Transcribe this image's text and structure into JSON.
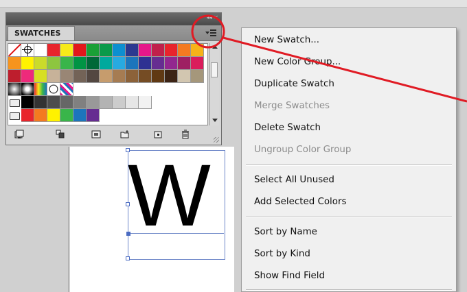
{
  "panel": {
    "tab_label": "SWATCHES",
    "menu_button_icon": "panel-flyout-menu-icon",
    "swatch_rows": [
      [
        "none",
        "registration",
        "#ffffff",
        "#e8252c",
        "#f6ea1a",
        "#e2171b",
        "#1aa036",
        "#0a9a4a",
        "#0d8fd0",
        "#2b3990",
        "#e5178a",
        "#c0204b",
        "#e8242c",
        "#f47a20",
        "#f6b319"
      ],
      [
        "#f7941d",
        "#fff200",
        "#cbdb2a",
        "#8dc63f",
        "#39b54a",
        "#009444",
        "#006838",
        "#00a99d",
        "#27aae1",
        "#1c75bc",
        "#2e3192",
        "#662d91",
        "#92278f",
        "#9e1f63",
        "#da1c5c"
      ],
      [
        "#be1e2d",
        "#ee2a7b",
        "#d7df23",
        "#c7b299",
        "#998675",
        "#736357",
        "#534741",
        "#c69c6d",
        "#a67c52",
        "#8c6239",
        "#754c24",
        "#603913",
        "#3c2415",
        "#d2c6b0",
        "#a5977b"
      ]
    ],
    "gradient_row": [
      "#c0c0c0",
      "#000000",
      "#e8a000",
      "#ffffff"
    ],
    "gray_row": [
      "#000000",
      "#333333",
      "#4d4d4d",
      "#666666",
      "#808080",
      "#999999",
      "#b3b3b3",
      "#cccccc",
      "#e6e6e6",
      "#f2f2f2"
    ],
    "color_group_row": [
      "#e8252c",
      "#f47a20",
      "#fff200",
      "#39b54a",
      "#1c75bc",
      "#662d91"
    ],
    "bottom_icons": [
      "swatch-libraries-menu-icon",
      "show-swatch-kinds-menu-icon",
      "swatch-options-icon",
      "new-color-group-icon",
      "new-swatch-icon",
      "delete-swatch-icon"
    ]
  },
  "menu": {
    "items": [
      {
        "label": "New Swatch...",
        "disabled": false
      },
      {
        "label": "New Color Group...",
        "disabled": false
      },
      {
        "label": "Duplicate Swatch",
        "disabled": false
      },
      {
        "label": "Merge Swatches",
        "disabled": true
      },
      {
        "label": "Delete Swatch",
        "disabled": false
      },
      {
        "label": "Ungroup Color Group",
        "disabled": true
      },
      {
        "label": "Select All Unused",
        "disabled": false
      },
      {
        "label": "Add Selected Colors",
        "disabled": false
      },
      {
        "label": "Sort by Name",
        "disabled": false
      },
      {
        "label": "Sort by Kind",
        "disabled": false
      },
      {
        "label": "Show Find Field",
        "disabled": false
      }
    ]
  },
  "artboard": {
    "letter": "W"
  },
  "colors": {
    "annotation_red": "#e01b24",
    "selection_blue": "#4a6bc2",
    "disabled_text": "#8c8c8c"
  }
}
